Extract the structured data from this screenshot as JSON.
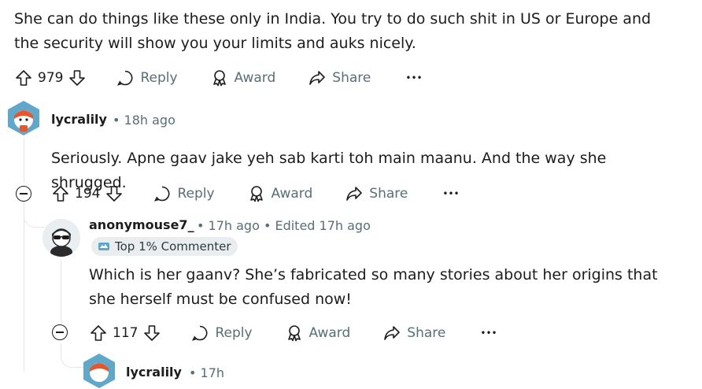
{
  "top_comment": {
    "body": "She can do things like these only in India. You try to do such shit in US or Europe and the security will show you your limits and auks nicely.",
    "votes": "979",
    "actions": {
      "reply": "Reply",
      "award": "Award",
      "share": "Share",
      "more": "•••"
    }
  },
  "comment_1": {
    "username": "lycralily",
    "time": "• 18h ago",
    "body": "Seriously. Apne gaav jake yeh sab karti toh main maanu. And the way she shrugged.",
    "votes": "194",
    "actions": {
      "reply": "Reply",
      "award": "Award",
      "share": "Share",
      "more": "•••"
    }
  },
  "comment_2": {
    "username": "anonymouse7_",
    "time": "• 17h ago • Edited 17h ago",
    "badge": "Top 1% Commenter",
    "body": "Which is her gaanv? She’s fabricated so many stories about her origins that she herself must be confused now!",
    "votes": "117",
    "actions": {
      "reply": "Reply",
      "award": "Award",
      "share": "Share",
      "more": "•••"
    }
  },
  "comment_3": {
    "username": "lycralily",
    "time": "• 17h"
  },
  "colors": {
    "meta_text": "#576f76",
    "thread_line": "#e2e7e9",
    "badge_bg": "#eaedef"
  }
}
